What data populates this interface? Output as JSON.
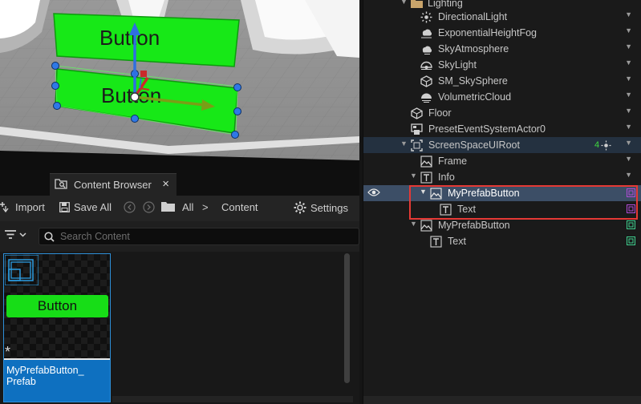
{
  "viewport": {
    "widget_top_label": "Button",
    "widget_bottom_label": "Button",
    "colors": {
      "widget_green": "#17e817",
      "floor": "#8f8f8f",
      "gizmo_x": "#7a9e16",
      "gizmo_z": "#2f6fe0"
    }
  },
  "content_browser": {
    "tab_label": "Content Browser",
    "close_glyph": "×",
    "toolbar": {
      "import_label": "Import",
      "save_all_label": "Save All",
      "path_all": "All",
      "path_separator": ">",
      "path_content": "Content",
      "settings_label": "Settings"
    },
    "search": {
      "placeholder": "Search Content"
    },
    "asset": {
      "preview_label": "Button",
      "name": "MyPrefabButton_ Prefab",
      "star_glyph": "*",
      "icon": "widget-prefab-icon"
    }
  },
  "outliner": {
    "rows": [
      {
        "label": "Lighting",
        "icon": "folder-icon"
      },
      {
        "label": "DirectionalLight",
        "icon": "directional-light-icon"
      },
      {
        "label": "ExponentialHeightFog",
        "icon": "fog-icon"
      },
      {
        "label": "SkyAtmosphere",
        "icon": "sky-atmosphere-icon"
      },
      {
        "label": "SkyLight",
        "icon": "skylight-icon"
      },
      {
        "label": "SM_SkySphere",
        "icon": "static-mesh-icon"
      },
      {
        "label": "VolumetricCloud",
        "icon": "cloud-icon"
      },
      {
        "label": "Floor",
        "icon": "static-mesh-icon"
      },
      {
        "label": "PresetEventSystemActor0",
        "icon": "actor-icon"
      },
      {
        "label": "ScreenSpaceUIRoot",
        "icon": "ui-root-icon",
        "badge": "4"
      },
      {
        "label": "Frame",
        "icon": "image-widget-icon"
      },
      {
        "label": "Info",
        "icon": "text-widget-icon"
      },
      {
        "label": "MyPrefabButton",
        "icon": "button-widget-icon"
      },
      {
        "label": "Text",
        "icon": "text-widget-icon"
      },
      {
        "label": "MyPrefabButton",
        "icon": "button-widget-icon"
      },
      {
        "label": "Text",
        "icon": "text-widget-icon"
      }
    ],
    "colors": {
      "selected_row": "#3c4e66",
      "highlight_box": "#e53935",
      "prefab_tag_purple": "#b04bd6",
      "prefab_tag_green": "#3fcf8e"
    }
  }
}
